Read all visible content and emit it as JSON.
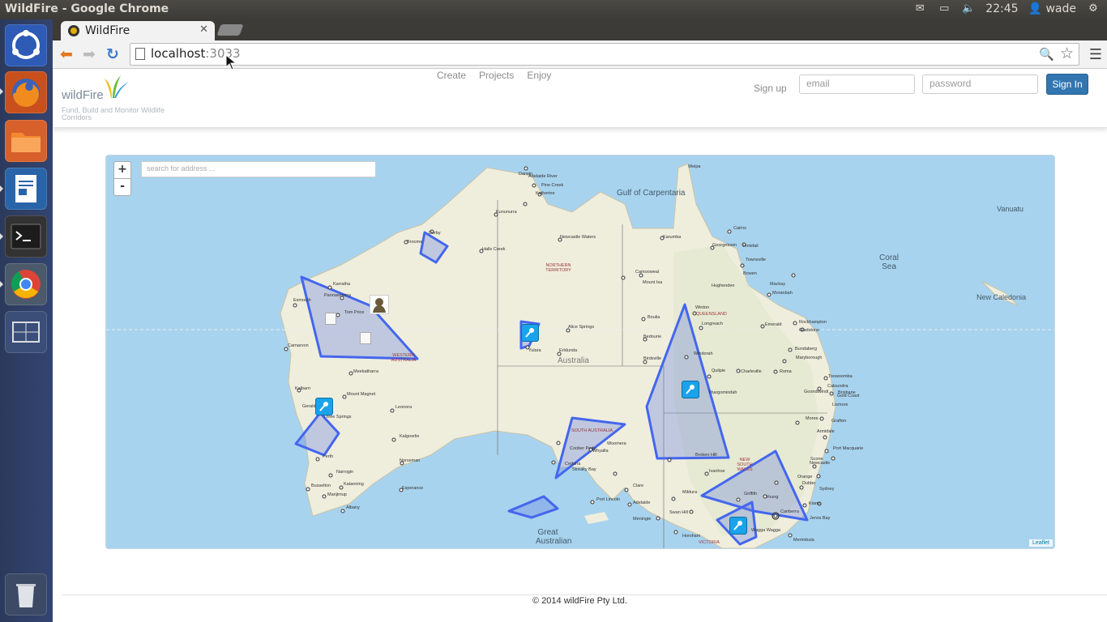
{
  "os": {
    "window_title": "WildFire - Google Chrome",
    "clock": "22:45",
    "user": "wade"
  },
  "browser": {
    "tab_title": "WildFire",
    "url_host": "localhost",
    "url_port": ":3033"
  },
  "site": {
    "logo_text": "wildFire",
    "tagline": "Fund, Build and Monitor Wildlife Corridors",
    "nav": [
      "Create",
      "Projects",
      "Enjoy"
    ],
    "signup_label": "Sign up",
    "email_placeholder": "email",
    "password_placeholder": "password",
    "signin_label": "Sign In"
  },
  "map": {
    "zoom_in": "+",
    "zoom_out": "-",
    "search_placeholder": "search for address ...",
    "attribution": "Leaflet",
    "colors": {
      "sea": "#a8d3ee",
      "land": "#efeedd",
      "project_fill": "#6680e0",
      "project_stroke": "#4466ee",
      "marker": "#1aa3ea"
    },
    "ocean_labels": [
      "Gulf of Carpentaria",
      "Coral Sea",
      "Great Australian",
      "Vanuatu",
      "New Caledonia"
    ],
    "country_label": "Australia",
    "state_labels": [
      "NORTHERN TERRITORY",
      "WESTERN AUSTRALIA",
      "SOUTH AUSTRALIA",
      "QUEENSLAND",
      "NEW SOUTH WALES",
      "VICTORIA"
    ],
    "city_labels": [
      "Weipa",
      "Darwin",
      "Adelaide River",
      "Pine Creek",
      "Katherine",
      "Kununurra",
      "Derby",
      "Broome",
      "Halls Creek",
      "Newcastle Waters",
      "Karumba",
      "Cairns",
      "Innisfail",
      "Georgetown",
      "Townsville",
      "Bowen",
      "Mackay",
      "Moranbah",
      "Camooweal",
      "Mount Isa",
      "Hughenden",
      "Karratha",
      "Pannawonica",
      "Exmouth",
      "Tom Price",
      "Carnarvon",
      "Alice Springs",
      "Yulara",
      "Erldunda",
      "Boulia",
      "Bedourie",
      "Birdsville",
      "Winton",
      "Longreach",
      "Emerald",
      "Rockhampton",
      "Gladstone",
      "Bundaberg",
      "Maryborough",
      "Windorah",
      "Quilpie",
      "Charleville",
      "Roma",
      "Toowoomba",
      "Brisbane",
      "Gold Coast",
      "Caloundra",
      "Meekatharra",
      "Kalbarri",
      "Mount Magnet",
      "Geraldton",
      "Three Springs",
      "Leonora",
      "Kalgoorlie",
      "Perth",
      "Norseman",
      "Narrogin",
      "Katanning",
      "Esperance",
      "Busselton",
      "Manjimup",
      "Albany",
      "Coober Pedy",
      "Ceduna",
      "Streaky Bay",
      "Whyalla",
      "Woomera",
      "Port Lincoln",
      "Clare",
      "Adelaide",
      "Broken Hill",
      "Thargomindah",
      "Ivanhoe",
      "Griffith",
      "Young",
      "Dubbo",
      "Orange",
      "Sydney",
      "Newcastle",
      "Canberra",
      "Mildura",
      "Swan Hill",
      "Horsham",
      "Meningie",
      "Merimbula",
      "Wagga Wagga",
      "Goondiwindi",
      "Moree",
      "Armidale",
      "Grafton",
      "Lismore",
      "Port Macquarie",
      "Scone",
      "Kiama",
      "Jervis Bay"
    ]
  },
  "footer": "© 2014 wildFire Pty Ltd."
}
